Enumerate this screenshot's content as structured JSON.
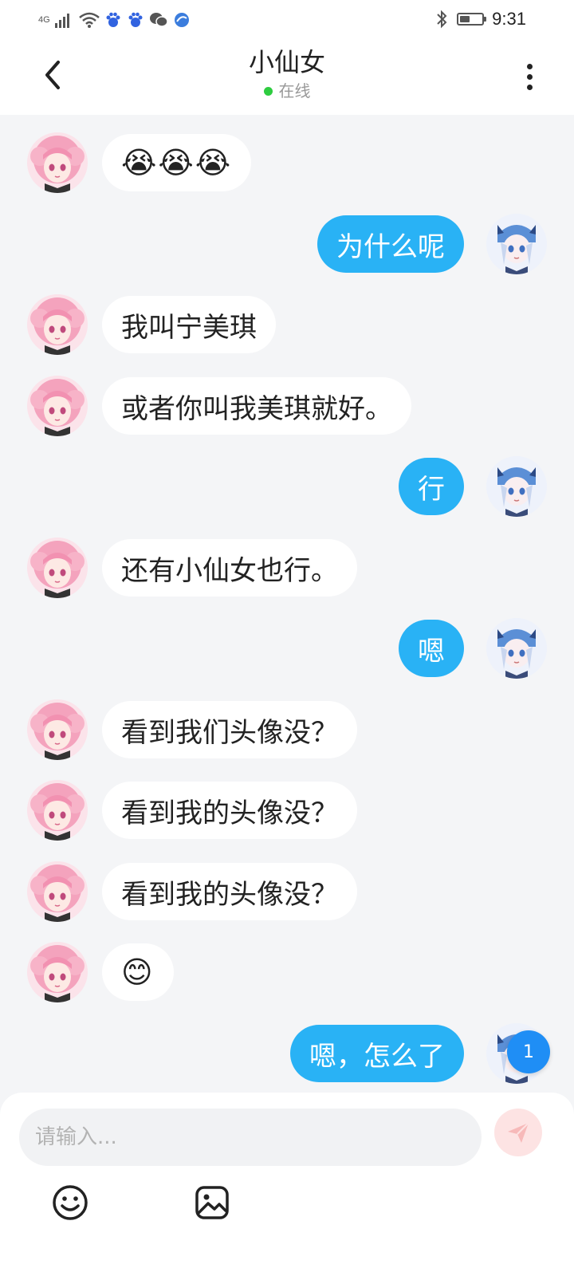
{
  "status_bar": {
    "network": "4G",
    "time": "9:31",
    "battery_level": 0.45,
    "icons": [
      "signal-icon",
      "wifi-icon",
      "baidu-icon",
      "baidu-icon",
      "wechat-icon",
      "browser-icon",
      "bluetooth-icon",
      "battery-icon"
    ]
  },
  "header": {
    "title": "小仙女",
    "status": "在线",
    "status_color": "#2ecc40"
  },
  "colors": {
    "outgoing_bubble": "#29b2f5",
    "incoming_bubble": "#ffffff",
    "background": "#f4f5f7",
    "badge": "#1f8ef5"
  },
  "messages": [
    {
      "direction": "in",
      "text": "😭😭😭",
      "type": "emoji"
    },
    {
      "direction": "out",
      "text": "为什么呢",
      "type": "text"
    },
    {
      "direction": "in",
      "text": "我叫宁美琪",
      "type": "text"
    },
    {
      "direction": "in",
      "text": "或者你叫我美琪就好。",
      "type": "text"
    },
    {
      "direction": "out",
      "text": "行",
      "type": "text"
    },
    {
      "direction": "in",
      "text": "还有小仙女也行。",
      "type": "text"
    },
    {
      "direction": "out",
      "text": "嗯",
      "type": "text"
    },
    {
      "direction": "in",
      "text": "看到我们头像没？",
      "type": "text"
    },
    {
      "direction": "in",
      "text": "看到我的头像没？",
      "type": "text"
    },
    {
      "direction": "in",
      "text": "看到我的头像没？",
      "type": "text"
    },
    {
      "direction": "in",
      "text": "😊",
      "type": "emoji"
    },
    {
      "direction": "out",
      "text": "嗯，怎么了",
      "type": "text"
    }
  ],
  "unread_badge": "1",
  "composer": {
    "placeholder": "请输入...",
    "value": ""
  },
  "toolbar": {
    "icons": [
      "emoji-icon",
      "image-icon",
      "send-icon"
    ]
  }
}
